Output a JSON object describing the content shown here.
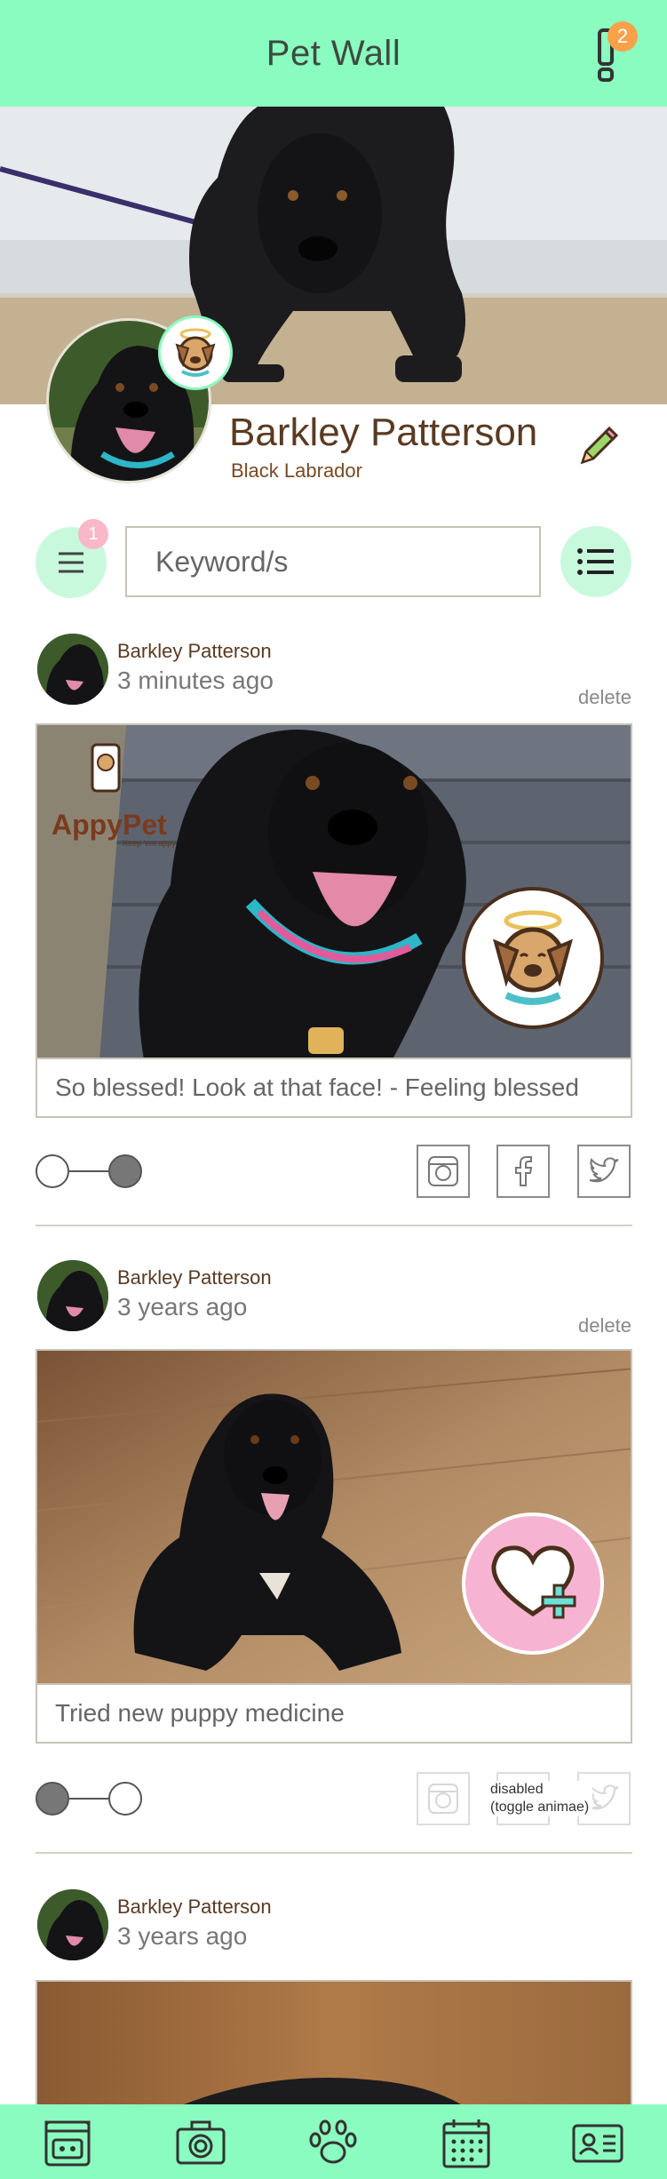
{
  "header": {
    "title": "Pet Wall",
    "notification_count": "2",
    "bell_icon": "exclamation-bell-icon"
  },
  "profile": {
    "name": "Barkley Patterson",
    "breed": "Black Labrador",
    "edit_icon": "pencil-icon",
    "badge_icon": "angel-dog-icon"
  },
  "search": {
    "menu_badge": "1",
    "placeholder": "Keyword/s",
    "menu_icon": "hamburger-icon",
    "list_icon": "list-icon"
  },
  "posts": [
    {
      "author": "Barkley Patterson",
      "time": "3 minutes ago",
      "delete_label": "delete",
      "caption": "So blessed! Look at that face! - Feeling blessed",
      "watermark": "AppyPet",
      "watermark_tagline": "Keep 'em appy",
      "mood_icon": "angel-dog-icon",
      "toggle_on": true,
      "share": [
        "instagram-icon",
        "facebook-icon",
        "twitter-icon"
      ]
    },
    {
      "author": "Barkley Patterson",
      "time": "3 years ago",
      "delete_label": "delete",
      "caption": "Tried new puppy medicine",
      "mood_icon": "heart-plus-icon",
      "toggle_on": false,
      "disabled_note_line1": "disabled",
      "disabled_note_line2": "(toggle animae)",
      "share": [
        "instagram-icon",
        "facebook-icon",
        "twitter-icon"
      ]
    },
    {
      "author": "Barkley Patterson",
      "time": "3 years ago"
    }
  ],
  "bottom_nav": [
    "dog-bowl-icon",
    "camera-icon",
    "paw-icon",
    "calendar-icon",
    "id-card-icon"
  ],
  "colors": {
    "accent": "#8bfcbf",
    "accent_light": "#c9f9dd",
    "text_brown": "#5a3a22",
    "badge_orange": "#f8a14a",
    "badge_pink": "#f8b8c8"
  }
}
